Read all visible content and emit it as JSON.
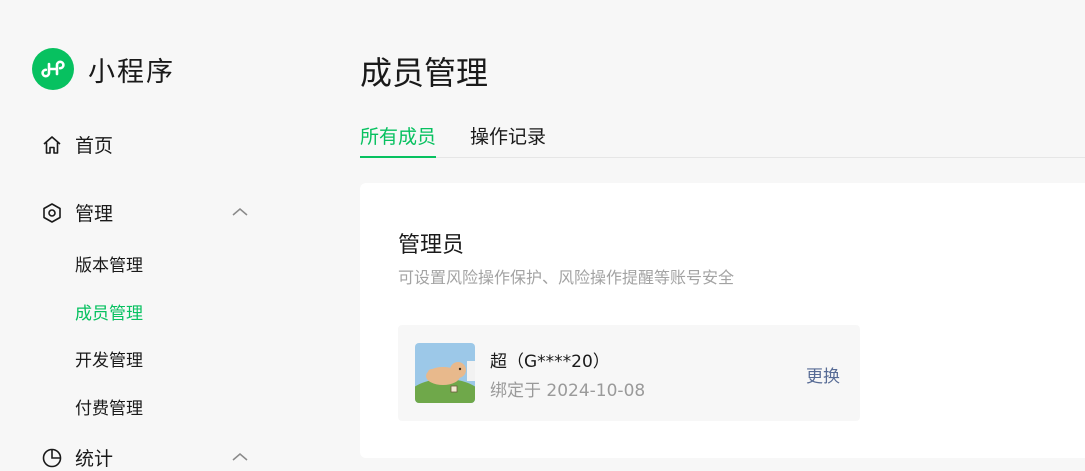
{
  "brand": {
    "name": "小程序",
    "logo_icon": "miniprogram-logo-icon",
    "accent": "#07c160"
  },
  "nav": {
    "home": {
      "label": "首页",
      "icon": "home-icon"
    },
    "manage": {
      "label": "管理",
      "icon": "hexagon-settings-icon",
      "expanded": true,
      "children": [
        {
          "label": "版本管理",
          "active": false
        },
        {
          "label": "成员管理",
          "active": true
        },
        {
          "label": "开发管理",
          "active": false
        },
        {
          "label": "付费管理",
          "active": false
        }
      ]
    },
    "stats": {
      "label": "统计",
      "icon": "pie-chart-icon",
      "expanded": true
    }
  },
  "main": {
    "title": "成员管理",
    "tabs": [
      {
        "label": "所有成员",
        "active": true
      },
      {
        "label": "操作记录",
        "active": false
      }
    ],
    "admin_card": {
      "title": "管理员",
      "description": "可设置风险操作保护、风险操作提醒等账号安全",
      "admin": {
        "name": "超（G****20）",
        "bound_date": "绑定于 2024-10-08",
        "action_label": "更换"
      }
    }
  }
}
